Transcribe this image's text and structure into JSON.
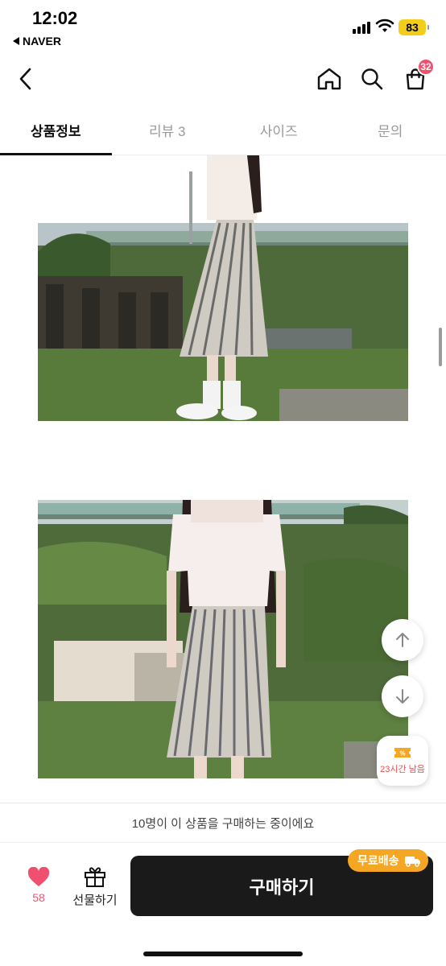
{
  "status_bar": {
    "time": "12:02",
    "back_app": "NAVER",
    "battery": "83"
  },
  "header": {
    "back_icon": "chevron-left-icon",
    "home_icon": "home-icon",
    "search_icon": "search-icon",
    "cart_icon": "shopping-bag-icon",
    "cart_count": "32"
  },
  "tabs": [
    {
      "label": "상품정보",
      "active": true
    },
    {
      "label": "리뷰 3",
      "active": false
    },
    {
      "label": "사이즈",
      "active": false
    },
    {
      "label": "문의",
      "active": false
    }
  ],
  "floating": {
    "scroll_up_icon": "arrow-up-icon",
    "scroll_down_icon": "arrow-down-icon",
    "coupon_icon": "coupon-icon",
    "coupon_text": "23시간 남음"
  },
  "buyer_notice": "10명이 이 상품을 구매하는 중이에요",
  "bottom_bar": {
    "like_icon": "heart-icon",
    "like_count": "58",
    "gift_icon": "gift-icon",
    "gift_label": "선물하기",
    "buy_label": "구매하기",
    "free_shipping_label": "무료배송",
    "truck_icon": "truck-icon"
  },
  "colors": {
    "accent_pink": "#f0506e",
    "free_shipping_orange": "#f5a623",
    "buy_button": "#1a1a1a"
  }
}
